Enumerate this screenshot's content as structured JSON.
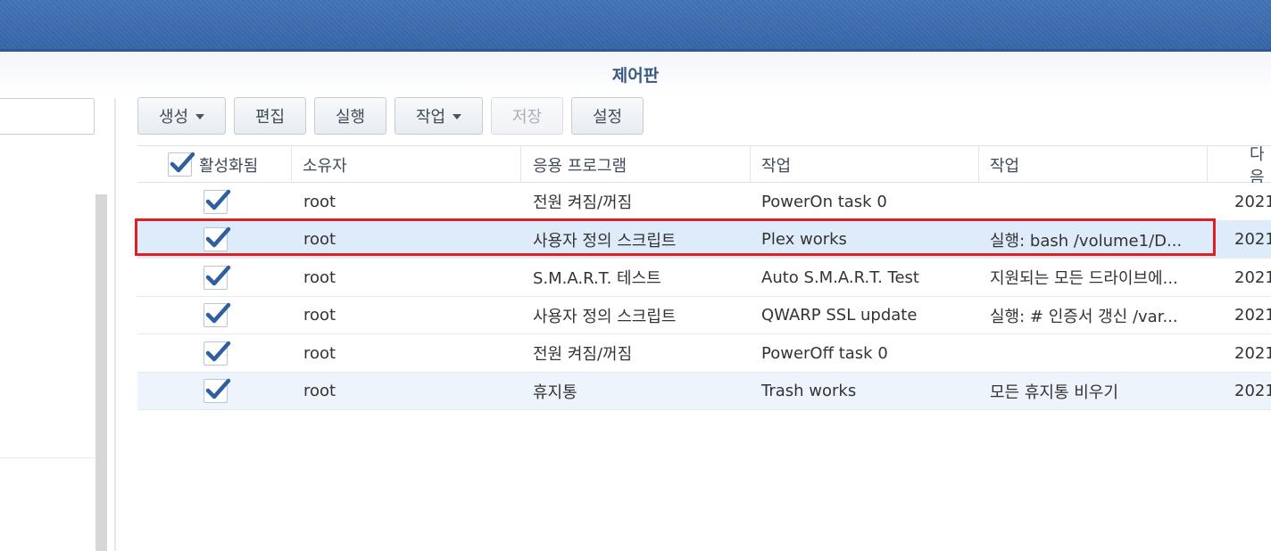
{
  "window": {
    "title": "제어판"
  },
  "toolbar": {
    "create": "생성",
    "edit": "편집",
    "run": "실행",
    "action": "작업",
    "save": "저장",
    "settings": "설정"
  },
  "grid": {
    "columns": [
      "활성화됨",
      "소유자",
      "응용 프로그램",
      "작업",
      "작업",
      "다음"
    ],
    "rows": [
      {
        "enabled": true,
        "owner": "root",
        "app": "전원 켜짐/꺼짐",
        "task": "PowerOn task 0",
        "action": "",
        "next": "2021"
      },
      {
        "enabled": true,
        "owner": "root",
        "app": "사용자 정의 스크립트",
        "task": "Plex works",
        "action": "실행: bash /volume1/D...",
        "next": "2021"
      },
      {
        "enabled": true,
        "owner": "root",
        "app": "S.M.A.R.T. 테스트",
        "task": "Auto S.M.A.R.T. Test",
        "action": "지원되는 모든 드라이브에...",
        "next": "2021"
      },
      {
        "enabled": true,
        "owner": "root",
        "app": "사용자 정의 스크립트",
        "task": "QWARP SSL update",
        "action": "실행: # 인증서 갱신 /var...",
        "next": "2021"
      },
      {
        "enabled": true,
        "owner": "root",
        "app": "전원 켜짐/꺼짐",
        "task": "PowerOff task 0",
        "action": "",
        "next": "2021"
      },
      {
        "enabled": true,
        "owner": "root",
        "app": "휴지통",
        "task": "Trash works",
        "action": "모든 휴지통 비우기",
        "next": "2021"
      }
    ]
  },
  "colors": {
    "accent": "#3b6cb0",
    "selected_row": "#deebfa",
    "highlight": "#e02020"
  }
}
